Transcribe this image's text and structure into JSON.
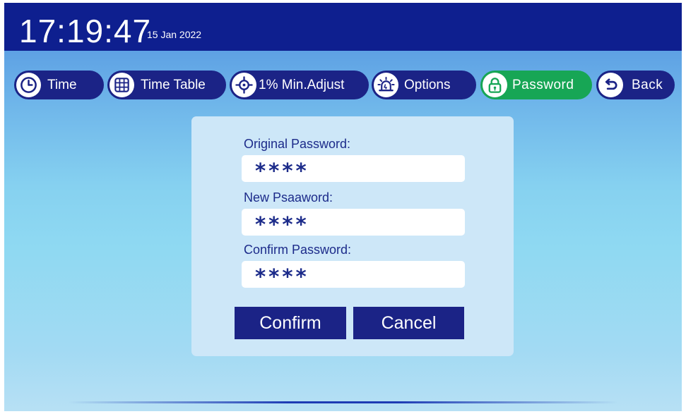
{
  "header": {
    "time": "17:19:47",
    "date": "15 Jan 2022"
  },
  "nav": {
    "items": [
      {
        "label": "Time",
        "icon": "clock-icon"
      },
      {
        "label": "Time Table",
        "icon": "grid-icon"
      },
      {
        "label": "1% Min.Adjust",
        "icon": "crosshair-icon"
      },
      {
        "label": "Options",
        "icon": "alarm-light-icon"
      },
      {
        "label": "Password",
        "icon": "lock-icon",
        "active": true
      },
      {
        "label": "Back",
        "icon": "back-arrow-icon"
      }
    ]
  },
  "form": {
    "original_label": "Original Password:",
    "original_value": "****",
    "new_label": "New Psaaword:",
    "new_value": "****",
    "confirm_label": "Confirm Password:",
    "confirm_value": "****",
    "confirm_button": "Confirm",
    "cancel_button": "Cancel"
  },
  "colors": {
    "header_bg": "#0e1f8f",
    "nav_bg": "#1b2386",
    "nav_active": "#17a655",
    "panel_bg": "#cde7f8",
    "text_dark": "#1c2b8a"
  }
}
